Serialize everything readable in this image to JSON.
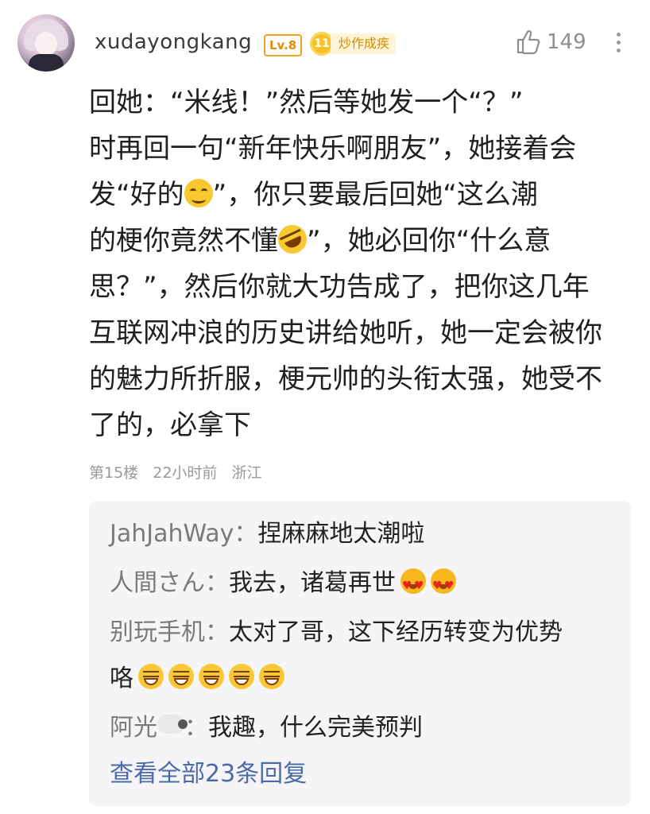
{
  "comment": {
    "username": "xudayongkang",
    "level": "Lv.8",
    "medal_number": "11",
    "medal_text": "炒作成疾",
    "like_count": "149",
    "content_lines": [
      "回她：“米线！”然后等她发一个“？”",
      "时再回一句“新年快乐啊朋友”，她接着会",
      "发“好的",
      "”，你只要最后回她“这么潮",
      "的梗你竟然不懂",
      "”，她必回你“什么意",
      "思？”，然后你就大功告成了，把你这几年",
      "互联网冲浪的历史讲给她听，她一定会被你",
      "的魅力所折服，梗元帅的头衔太强，她受不",
      "了的，必拿下"
    ],
    "emojis": {
      "smile": "smiling-face-emoji",
      "rofl": "rolling-laughing-emoji"
    },
    "floor": "第15楼",
    "time": "22小时前",
    "location": "浙江"
  },
  "replies": [
    {
      "name": "JahJahWay：",
      "text": "捏麻麻地太潮啦",
      "emoji": "",
      "emoji_count": 0
    },
    {
      "name": "人間さん：",
      "text": "我去，诸葛再世",
      "emoji": "heart-eyes",
      "emoji_count": 2
    },
    {
      "name": "别玩手机：",
      "text": "太对了哥，这下经历转变为优势",
      "emoji": "",
      "emoji_count": 0
    },
    {
      "name": "",
      "text": "咯",
      "emoji": "grin",
      "emoji_count": 5
    },
    {
      "name": "阿光",
      "name_suffix": "：",
      "text": "我趣，什么完美预判",
      "emoji": "sheep",
      "emoji_count": 0
    }
  ],
  "view_all": "查看全部23条回复",
  "colors": {
    "level": "#e58d00",
    "medal_bg": "#fff4d6",
    "reply_bg": "#f5f5f7",
    "link": "#4a6aa8",
    "meta": "#9a9a9a"
  }
}
